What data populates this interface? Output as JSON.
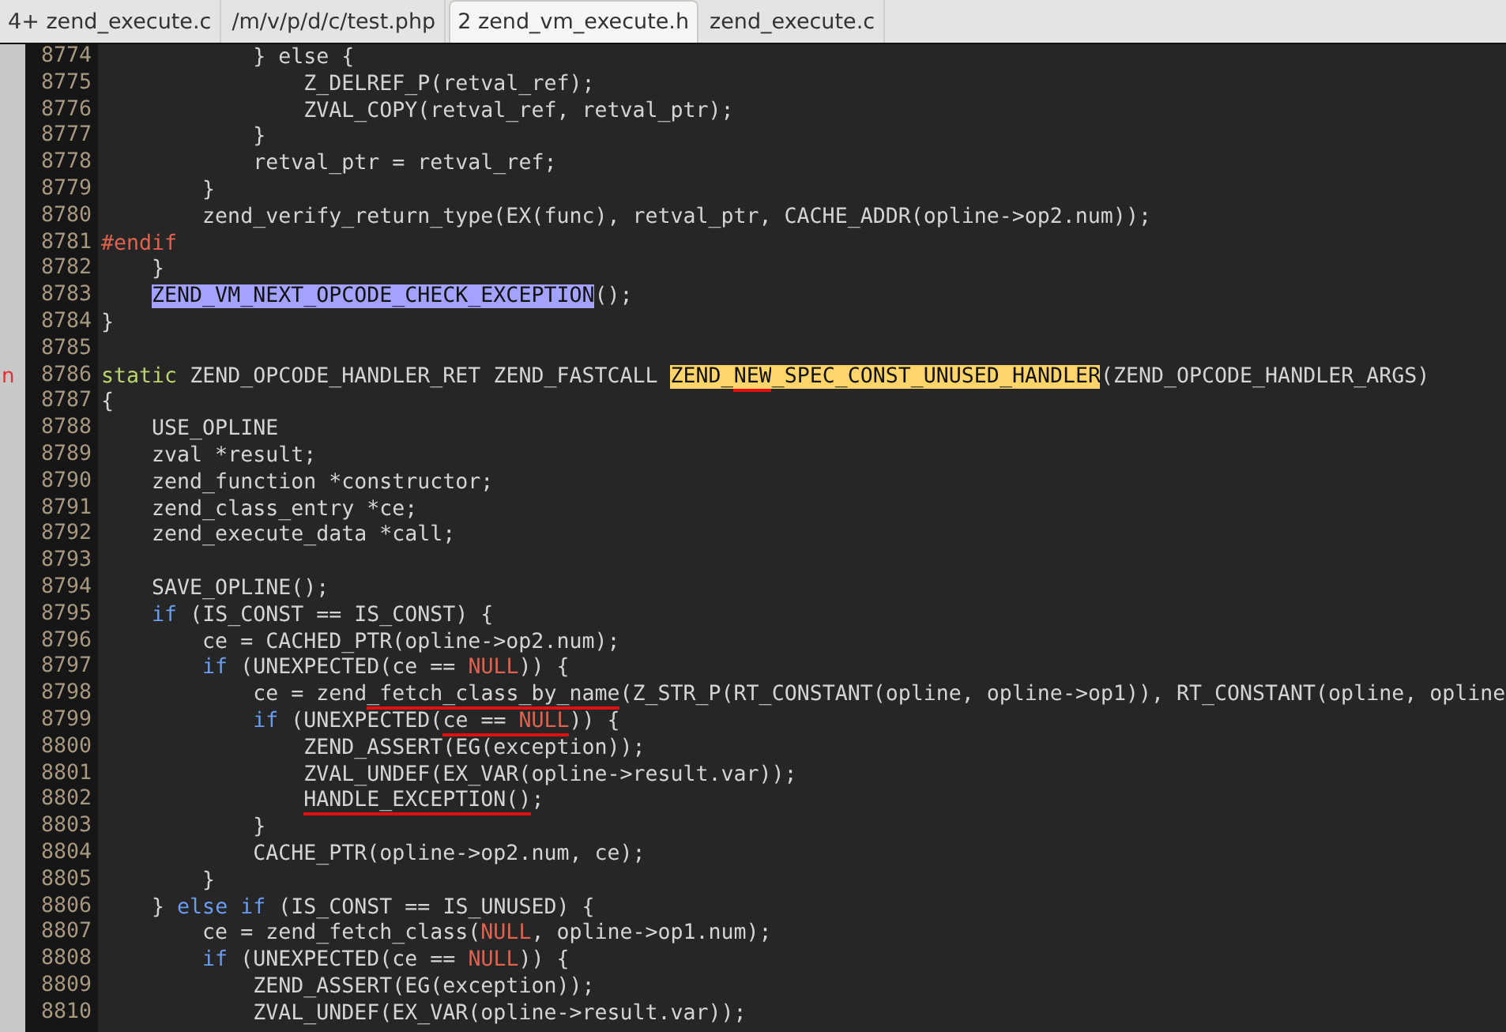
{
  "tabs": [
    {
      "label": "4+ zend_execute.c",
      "selected": false
    },
    {
      "label": "/m/v/p/d/c/test.php",
      "selected": false
    },
    {
      "label": "2 zend_vm_execute.h",
      "selected": true
    },
    {
      "label": "zend_execute.c",
      "selected": false
    }
  ],
  "editor": {
    "lines": [
      {
        "number": "8774",
        "tokens": [
          "            } else {"
        ]
      },
      {
        "number": "8775",
        "tokens": [
          "                Z_DELREF_P(retval_ref);"
        ]
      },
      {
        "number": "8776",
        "tokens": [
          "                ZVAL_COPY(retval_ref, retval_ptr);"
        ]
      },
      {
        "number": "8777",
        "tokens": [
          "            }"
        ]
      },
      {
        "number": "8778",
        "tokens": [
          "            retval_ptr = retval_ref;"
        ]
      },
      {
        "number": "8779",
        "tokens": [
          "        }"
        ]
      },
      {
        "number": "8780",
        "tokens": [
          "        zend_verify_return_type(EX(func), retval_ptr, CACHE_ADDR(opline->op2.num));"
        ]
      },
      {
        "number": "8781",
        "tokens": [
          {
            "kind": "preprocessor",
            "text": "#endif"
          }
        ]
      },
      {
        "number": "8782",
        "tokens": [
          "    }"
        ]
      },
      {
        "number": "8783",
        "tokens": [
          {
            "kind": "search-match",
            "text": "    ZEND_VM_NEXT_OPCODE_CHECK_EXCEPTION"
          },
          "();"
        ]
      },
      {
        "number": "8784",
        "tokens": [
          "}"
        ]
      },
      {
        "number": "8785"
      },
      {
        "number": "8786",
        "gutter_mark": "n",
        "tokens": [
          {
            "kind": "storage",
            "text": "static"
          },
          " ZEND_OPCODE_HANDLER_RET ZEND_FASTCALL ",
          {
            "kind": "word-match",
            "text": "ZEND_"
          },
          {
            "kind": "word-match",
            "text": "NEW",
            "underlined": true
          },
          {
            "kind": "word-match",
            "text": "_SPEC_CONST_UNUSED_HANDLER"
          },
          "(ZEND_OPCODE_HANDLER_ARGS)"
        ]
      },
      {
        "number": "8787",
        "tokens": [
          "{"
        ]
      },
      {
        "number": "8788",
        "tokens": [
          "    USE_OPLINE"
        ]
      },
      {
        "number": "8789",
        "tokens": [
          "    zval *result;"
        ]
      },
      {
        "number": "8790",
        "tokens": [
          "    zend_function *constructor;"
        ]
      },
      {
        "number": "8791",
        "tokens": [
          "    zend_class_entry *ce;"
        ]
      },
      {
        "number": "8792",
        "tokens": [
          "    zend_execute_data *call;"
        ]
      },
      {
        "number": "8793"
      },
      {
        "number": "8794",
        "tokens": [
          "    SAVE_OPLINE();"
        ]
      },
      {
        "number": "8795",
        "tokens": [
          {
            "kind": "keyword",
            "text": "    if"
          },
          " (IS_CONST == IS_CONST) {"
        ]
      },
      {
        "number": "8796",
        "tokens": [
          "        ce = CACHED_PTR(opline->op2.num);"
        ]
      },
      {
        "number": "8797",
        "tokens": [
          {
            "kind": "keyword",
            "text": "        if"
          },
          " (UNEXPECTED(ce == ",
          {
            "kind": "constant",
            "text": "NULL"
          },
          ")) {"
        ]
      },
      {
        "number": "8798",
        "tokens": [
          "            ce = zend",
          {
            "kind": "plain",
            "text": "_fetch_class_by_name",
            "underlined": true
          },
          "(Z_STR_P(RT_CONSTANT(opline, opline->op1)), RT_CONSTANT(opline, opline"
        ]
      },
      {
        "number": "8799",
        "tokens": [
          {
            "kind": "keyword",
            "text": "            if"
          },
          " (UNEXPECTED(",
          {
            "kind": "plain",
            "text": "ce == ",
            "underlined": true
          },
          {
            "kind": "constant",
            "text": "NULL",
            "underlined": true
          },
          ")) {"
        ]
      },
      {
        "number": "8800",
        "tokens": [
          "                ZEND_ASSERT(EG(exception));"
        ]
      },
      {
        "number": "8801",
        "tokens": [
          "                ZVAL_UNDEF(EX_VAR(opline->result.var));"
        ]
      },
      {
        "number": "8802",
        "tokens": [
          {
            "kind": "plain",
            "text": "                HANDLE_EXCEPTION()",
            "underlined": true
          },
          ";"
        ]
      },
      {
        "number": "8803",
        "tokens": [
          "            }"
        ]
      },
      {
        "number": "8804",
        "tokens": [
          "            CACHE_PTR(opline->op2.num, ce);"
        ]
      },
      {
        "number": "8805",
        "tokens": [
          "        }"
        ]
      },
      {
        "number": "8806",
        "tokens": [
          "    } ",
          {
            "kind": "keyword",
            "text": "else"
          },
          {
            "kind": "keyword",
            "text": " if"
          },
          " (IS_CONST == IS_UNUSED) {"
        ]
      },
      {
        "number": "8807",
        "tokens": [
          "        ce = zend_fetch_class(",
          {
            "kind": "constant",
            "text": "NULL"
          },
          ", opline->op1.num);"
        ]
      },
      {
        "number": "8808",
        "tokens": [
          {
            "kind": "keyword",
            "text": "        if"
          },
          " (UNEXPECTED(ce == ",
          {
            "kind": "constant",
            "text": "NULL"
          },
          ")) {"
        ]
      },
      {
        "number": "8809",
        "tokens": [
          "            ZEND_ASSERT(EG(exception));"
        ]
      },
      {
        "number": "8810",
        "tokens": [
          "            ZVAL_UNDEF(EX_VAR(opline->result.var));"
        ]
      }
    ]
  }
}
